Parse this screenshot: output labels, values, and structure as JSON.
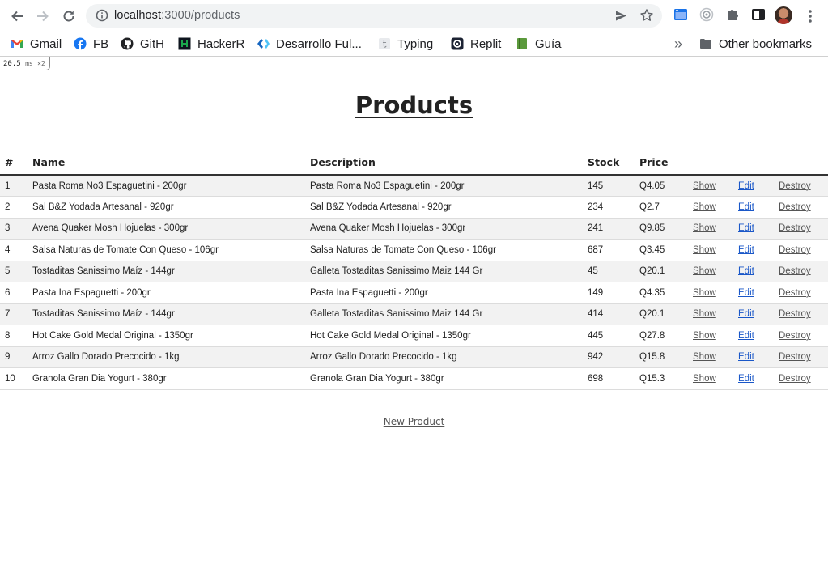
{
  "browser": {
    "url_host": "localhost",
    "url_path": ":3000/products",
    "bookmarks": [
      {
        "label": "Gmail",
        "icon": "gmail-icon"
      },
      {
        "label": "FB",
        "icon": "facebook-icon"
      },
      {
        "label": "GitH",
        "icon": "github-icon"
      },
      {
        "label": "HackerR",
        "icon": "hackerrank-icon"
      },
      {
        "label": "Desarrollo Ful...",
        "icon": "platzi-icon"
      },
      {
        "label": "Typing",
        "icon": "typing-icon"
      },
      {
        "label": "Replit",
        "icon": "replit-icon"
      },
      {
        "label": "Guía",
        "icon": "book-icon"
      }
    ],
    "other_bookmarks": "Other bookmarks",
    "overflow": "»"
  },
  "perf": {
    "value": "20.5",
    "unit": "ms",
    "count": "×2"
  },
  "page": {
    "title": "Products",
    "new_product": "New Product"
  },
  "table": {
    "headers": {
      "num": "#",
      "name": "Name",
      "description": "Description",
      "stock": "Stock",
      "price": "Price"
    },
    "actions": {
      "show": "Show",
      "edit": "Edit",
      "destroy": "Destroy"
    },
    "rows": [
      {
        "num": "1",
        "name": "Pasta Roma No3 Espaguetini - 200gr",
        "description": "Pasta Roma No3 Espaguetini - 200gr",
        "stock": "145",
        "price": "Q4.05"
      },
      {
        "num": "2",
        "name": "Sal B&Z Yodada Artesanal - 920gr",
        "description": "Sal B&Z Yodada Artesanal - 920gr",
        "stock": "234",
        "price": "Q2.7"
      },
      {
        "num": "3",
        "name": "Avena Quaker Mosh Hojuelas - 300gr",
        "description": "Avena Quaker Mosh Hojuelas - 300gr",
        "stock": "241",
        "price": "Q9.85"
      },
      {
        "num": "4",
        "name": "Salsa Naturas de Tomate Con Queso - 106gr",
        "description": "Salsa Naturas de Tomate Con Queso - 106gr",
        "stock": "687",
        "price": "Q3.45"
      },
      {
        "num": "5",
        "name": "Tostaditas Sanissimo Maíz - 144gr",
        "description": "Galleta Tostaditas Sanissimo Maiz 144 Gr",
        "stock": "45",
        "price": "Q20.1"
      },
      {
        "num": "6",
        "name": "Pasta Ina Espaguetti - 200gr",
        "description": "Pasta Ina Espaguetti - 200gr",
        "stock": "149",
        "price": "Q4.35"
      },
      {
        "num": "7",
        "name": "Tostaditas Sanissimo Maíz - 144gr",
        "description": "Galleta Tostaditas Sanissimo Maiz 144 Gr",
        "stock": "414",
        "price": "Q20.1"
      },
      {
        "num": "8",
        "name": "Hot Cake Gold Medal Original - 1350gr",
        "description": "Hot Cake Gold Medal Original - 1350gr",
        "stock": "445",
        "price": "Q27.8"
      },
      {
        "num": "9",
        "name": "Arroz Gallo Dorado Precocido - 1kg",
        "description": "Arroz Gallo Dorado Precocido - 1kg",
        "stock": "942",
        "price": "Q15.8"
      },
      {
        "num": "10",
        "name": "Granola Gran Dia Yogurt - 380gr",
        "description": "Granola Gran Dia Yogurt - 380gr",
        "stock": "698",
        "price": "Q15.3"
      }
    ]
  }
}
